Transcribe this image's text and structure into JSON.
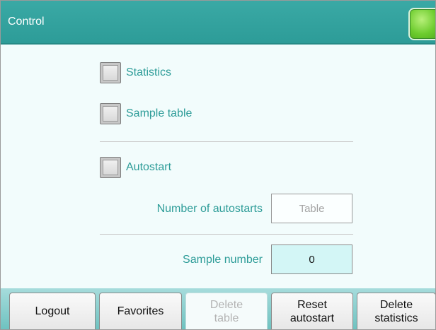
{
  "header": {
    "title": "Control",
    "status_color": "#6dcc2e"
  },
  "checks": {
    "statistics": {
      "label": "Statistics",
      "checked": false
    },
    "sample_table": {
      "label": "Sample table",
      "checked": false
    },
    "autostart": {
      "label": "Autostart",
      "checked": false
    }
  },
  "fields": {
    "number_of_autostarts": {
      "label": "Number of autostarts",
      "value": "Table"
    },
    "sample_number": {
      "label": "Sample number",
      "value": "0"
    }
  },
  "buttons": {
    "logout": "Logout",
    "favorites": "Favorites",
    "delete_table": "Delete\ntable",
    "reset_autostart": "Reset\nautostart",
    "delete_statistics": "Delete\nstatistics"
  },
  "colors": {
    "accent": "#2d9c98",
    "background": "#f2fcfc",
    "input_bg": "#d3f6f6"
  }
}
